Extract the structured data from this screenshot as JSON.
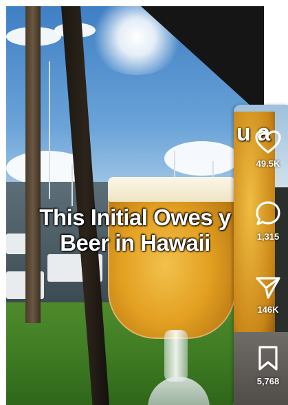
{
  "video": {
    "caption_line1": "This Initial Owes y",
    "caption_line2": "Beer in Hawaii"
  },
  "next_card": {
    "caption_fragment": "u a"
  },
  "actions": {
    "likes": "49.5K",
    "comments": "1,315",
    "shares": "146K",
    "saves": "5,768"
  },
  "icons": [
    "heart-icon",
    "comment-icon",
    "share-icon",
    "bookmark-icon"
  ]
}
